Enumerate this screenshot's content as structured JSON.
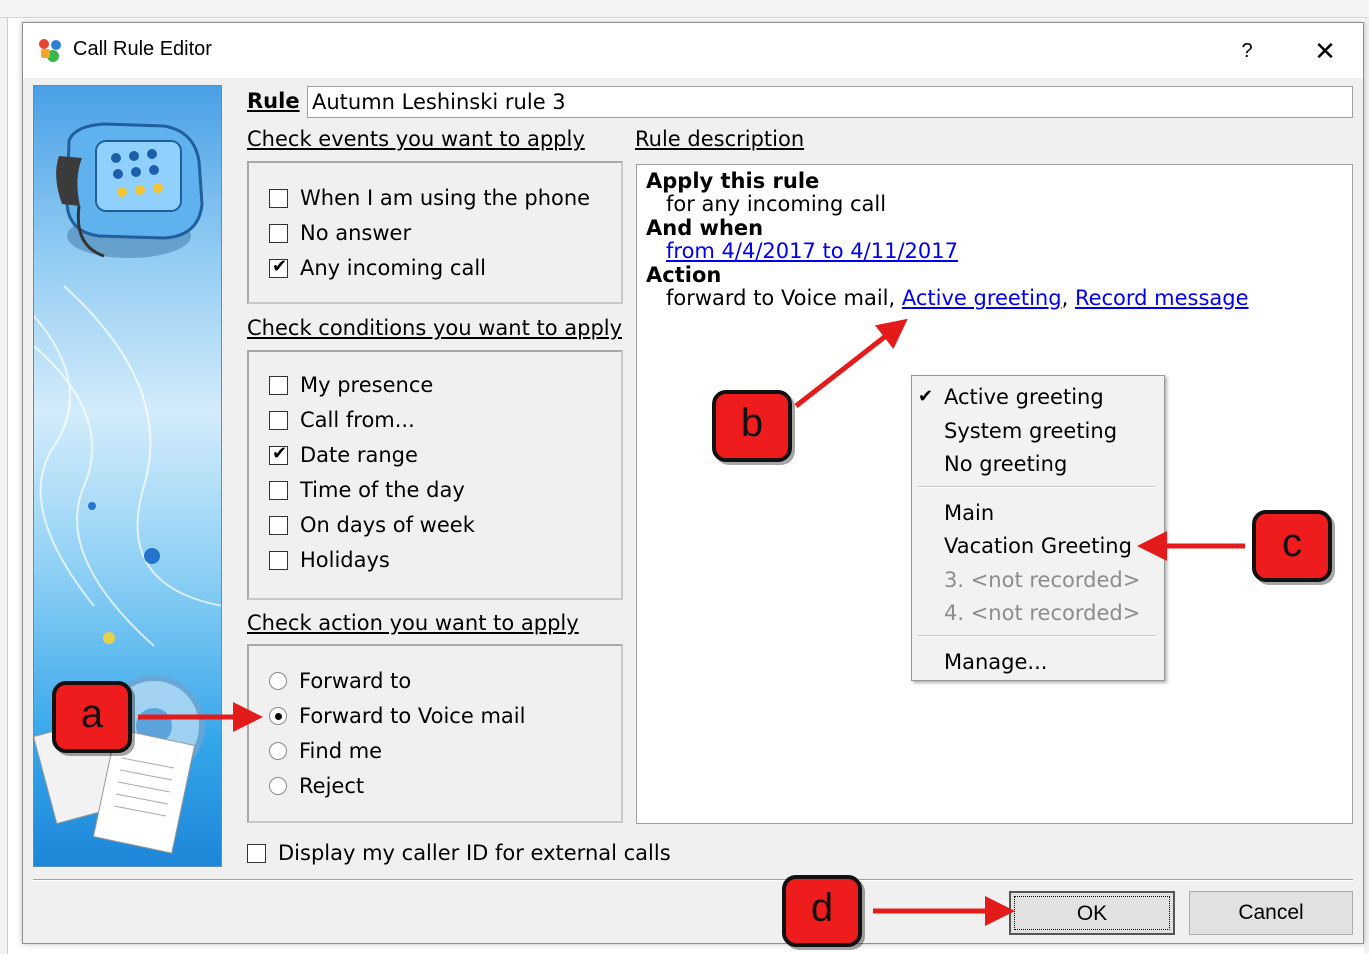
{
  "dialog": {
    "title": "Call Rule Editor",
    "help": "?",
    "close": "✕"
  },
  "rule": {
    "label": "Rule",
    "name": "Autumn Leshinski rule 3"
  },
  "events": {
    "heading": "Check events you want to apply",
    "items": [
      {
        "label": "When I am using the phone",
        "checked": false
      },
      {
        "label": "No answer",
        "checked": false
      },
      {
        "label": "Any incoming call",
        "checked": true
      }
    ]
  },
  "conditions": {
    "heading": "Check conditions you want to apply",
    "items": [
      {
        "label": "My presence",
        "checked": false
      },
      {
        "label": "Call from...",
        "checked": false
      },
      {
        "label": "Date range",
        "checked": true
      },
      {
        "label": "Time of the day",
        "checked": false
      },
      {
        "label": "On days of week",
        "checked": false
      },
      {
        "label": "Holidays",
        "checked": false
      }
    ]
  },
  "actions": {
    "heading": "Check action you want to apply",
    "items": [
      {
        "label": "Forward to",
        "selected": false
      },
      {
        "label": "Forward to Voice mail",
        "selected": true
      },
      {
        "label": "Find me",
        "selected": false
      },
      {
        "label": "Reject",
        "selected": false
      }
    ]
  },
  "description": {
    "heading": "Rule description",
    "apply_head": "Apply this rule",
    "apply_text": "for any incoming call",
    "when_head": "And when",
    "when_link": "from 4/4/2017 to 4/11/2017",
    "action_head": "Action",
    "action_text": "forward to Voice mail,",
    "action_link1": "Active greeting",
    "comma": ",",
    "action_link2": "Record message"
  },
  "greeting_menu": {
    "items": [
      {
        "label": "Active greeting",
        "checked": true,
        "enabled": true
      },
      {
        "label": "System greeting",
        "checked": false,
        "enabled": true
      },
      {
        "label": "No greeting",
        "checked": false,
        "enabled": true
      },
      {
        "label": "Main",
        "checked": false,
        "enabled": true
      },
      {
        "label": "Vacation Greeting",
        "checked": false,
        "enabled": true
      },
      {
        "label": "3. <not recorded>",
        "checked": false,
        "enabled": false
      },
      {
        "label": "4. <not recorded>",
        "checked": false,
        "enabled": false
      },
      {
        "label": "Manage...",
        "checked": false,
        "enabled": true
      }
    ]
  },
  "caller_id": {
    "label": "Display my caller ID for external calls",
    "checked": false
  },
  "buttons": {
    "ok": "OK",
    "cancel": "Cancel"
  },
  "annotations": {
    "a": "a",
    "b": "b",
    "c": "c",
    "d": "d",
    "arrow_color": "#e41b1b"
  }
}
